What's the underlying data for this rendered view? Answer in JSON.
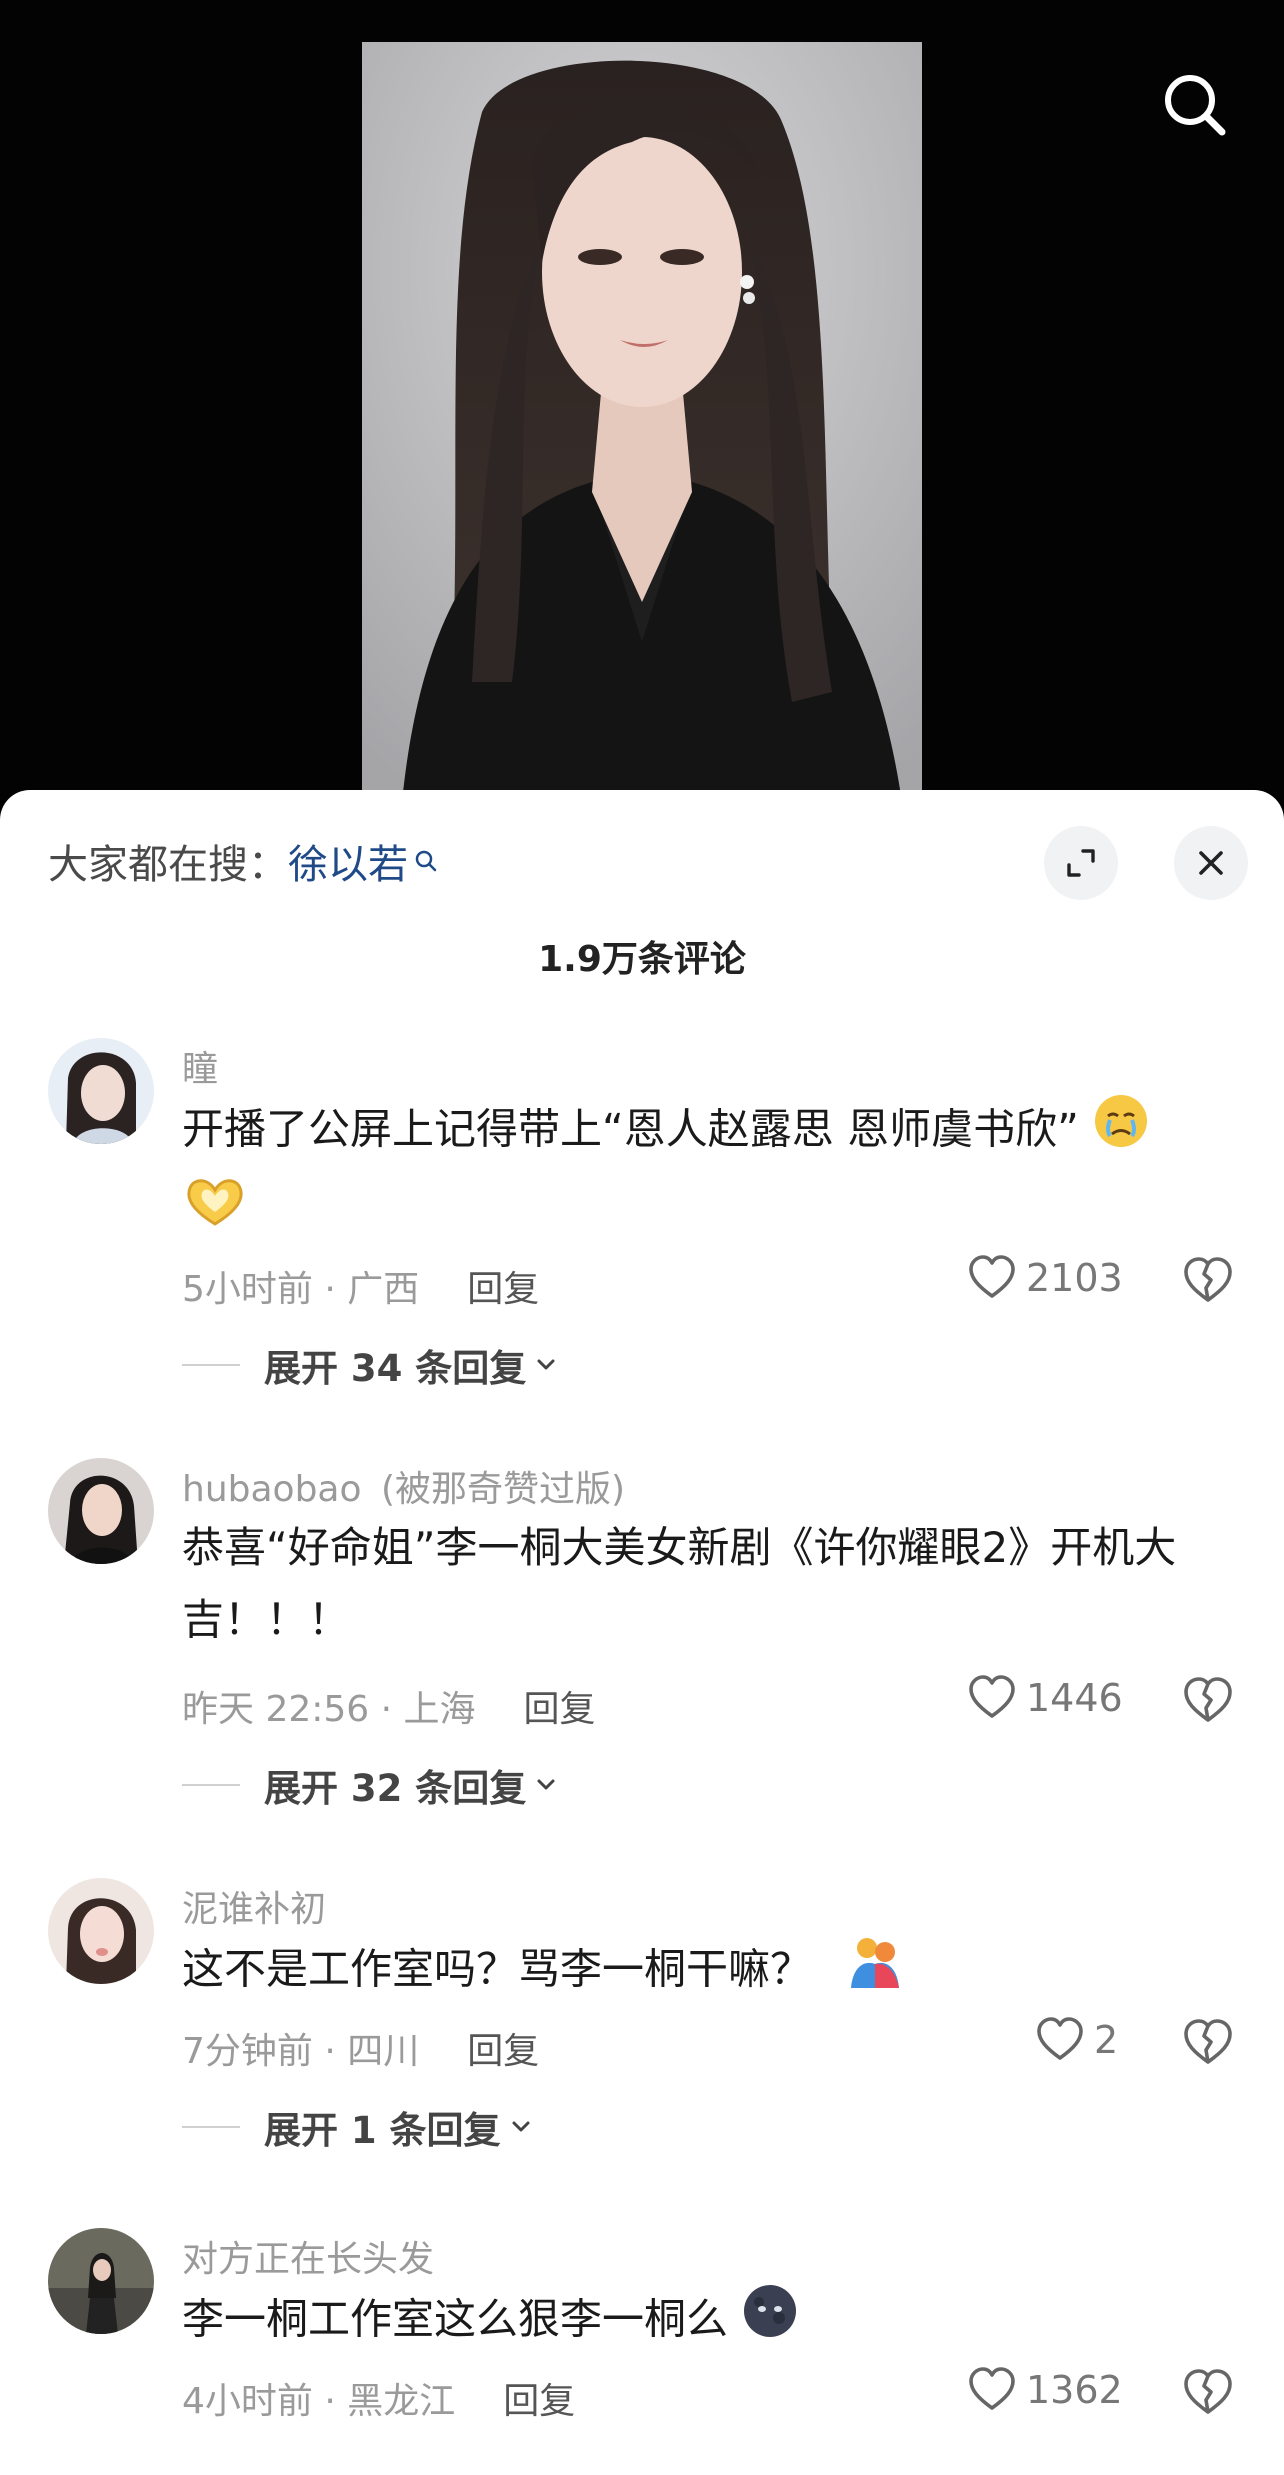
{
  "trending": {
    "label": "大家都在搜：",
    "term": "徐以若"
  },
  "comment_count": "1.9万条评论",
  "comments": [
    {
      "user": "瞳",
      "text": "开播了公屏上记得带上“恩人赵露思 恩师虞书欣”",
      "meta": "5小时前 · 广西",
      "reply": "回复",
      "likes": "2103",
      "expand": "展开 34 条回复"
    },
    {
      "user": "hubaobao",
      "badge": "(被那奇赞过版)",
      "text": "恭喜“好命姐”李一桐大美女新剧《许你耀眼2》开机大吉！！！",
      "meta": "昨天 22:56 · 上海",
      "reply": "回复",
      "likes": "1446",
      "expand": "展开 32 条回复"
    },
    {
      "user": "泥谁补初",
      "text": "这不是工作室吗？骂李一桐干嘛？",
      "meta": "7分钟前 · 四川",
      "reply": "回复",
      "likes": "2",
      "expand": "展开 1 条回复"
    },
    {
      "user": "对方正在长头发",
      "text": "李一桐工作室这么狠李一桐么",
      "meta": "4小时前 · 黑龙江",
      "reply": "回复",
      "likes": "1362"
    }
  ],
  "colors": {
    "link": "#1f4a87",
    "muted": "#9a9a9a",
    "text": "#1a1a1a",
    "sheet_bg": "#ffffff"
  },
  "icons": [
    "search-icon",
    "expand-icon",
    "close-icon",
    "heart-icon",
    "broken-heart-icon",
    "chevron-down-icon"
  ]
}
